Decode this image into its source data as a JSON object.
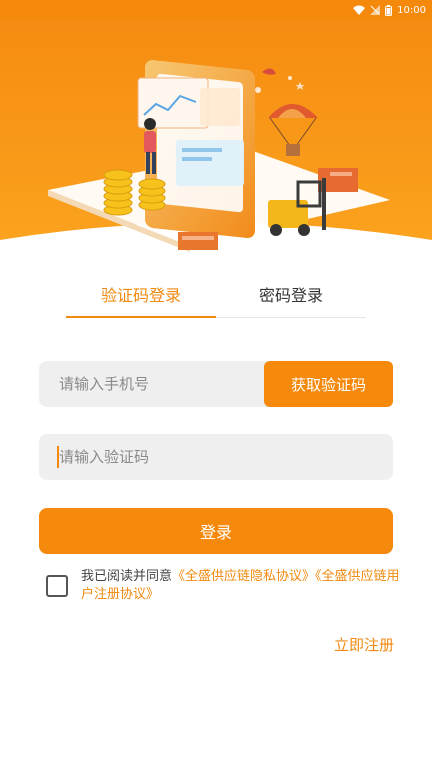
{
  "status_bar": {
    "time": "10:00",
    "icons": [
      "wifi-icon",
      "no-signal-icon",
      "battery-icon"
    ]
  },
  "banner": {
    "illustration": "logistics-warehouse-illustration"
  },
  "tabs": [
    {
      "label": "验证码登录",
      "active": true
    },
    {
      "label": "密码登录",
      "active": false
    }
  ],
  "form": {
    "phone_placeholder": "请输入手机号",
    "get_code_label": "获取验证码",
    "code_placeholder": "请输入验证码",
    "login_label": "登录"
  },
  "agreement": {
    "prefix": "我已阅读并同意",
    "privacy_link": "《全盛供应链隐私协议》",
    "user_link": "《全盛供应链用户注册协议》",
    "checked": false
  },
  "register_label": "立即注册",
  "colors": {
    "accent": "#f5890c",
    "accent_text": "#f0890f",
    "input_bg": "#efefef"
  }
}
